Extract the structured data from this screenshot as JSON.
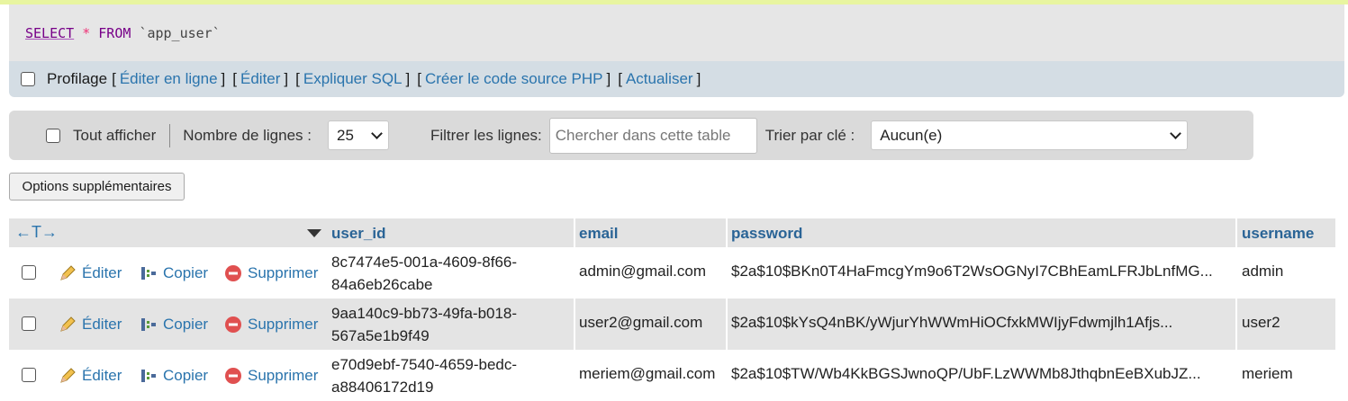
{
  "query": {
    "select": "SELECT",
    "star": "*",
    "from": "FROM",
    "table": "`app_user`"
  },
  "profiling": {
    "label": "Profilage",
    "links": [
      "Éditer en ligne",
      "Éditer",
      "Expliquer SQL",
      "Créer le code source PHP",
      "Actualiser"
    ]
  },
  "nav": {
    "show_all": "Tout afficher",
    "rows_label": "Nombre de lignes :",
    "rows_value": "25",
    "filter_label": "Filtrer les lignes:",
    "filter_placeholder": "Chercher dans cette table",
    "sort_label": "Trier par clé :",
    "sort_value": "Aucun(e)"
  },
  "extra_options": "Options supplémentaires",
  "table": {
    "headers": [
      "user_id",
      "email",
      "password",
      "username"
    ],
    "actions": {
      "edit": "Éditer",
      "copy": "Copier",
      "delete": "Supprimer"
    },
    "rows": [
      {
        "id1": "8c7474e5-001a-4609-8f66-",
        "id2": "84a6eb26cabe",
        "email": "admin@gmail.com",
        "password": "$2a$10$BKn0T4HaFmcgYm9o6T2WsOGNyI7CBhEamLFRJbLnfMG...",
        "username": "admin"
      },
      {
        "id1": "9aa140c9-bb73-49fa-b018-",
        "id2": "567a5e1b9f49",
        "email": "user2@gmail.com",
        "password": "$2a$10$kYsQ4nBK/yWjurYhWWmHiOCfxkMWIjyFdwmjlh1Afjs...",
        "username": "user2"
      },
      {
        "id1": "e70d9ebf-7540-4659-bedc-",
        "id2": "a88406172d19",
        "email": "meriem@gmail.com",
        "password": "$2a$10$TW/Wb4KkBGSJwnoQP/UbF.LzWWMb8JthqbnEeBXubJZ...",
        "username": "meriem"
      }
    ]
  },
  "colors": {
    "link": "#2a74ad",
    "header_text": "#2a6496",
    "sql_keyword": "#770088"
  }
}
